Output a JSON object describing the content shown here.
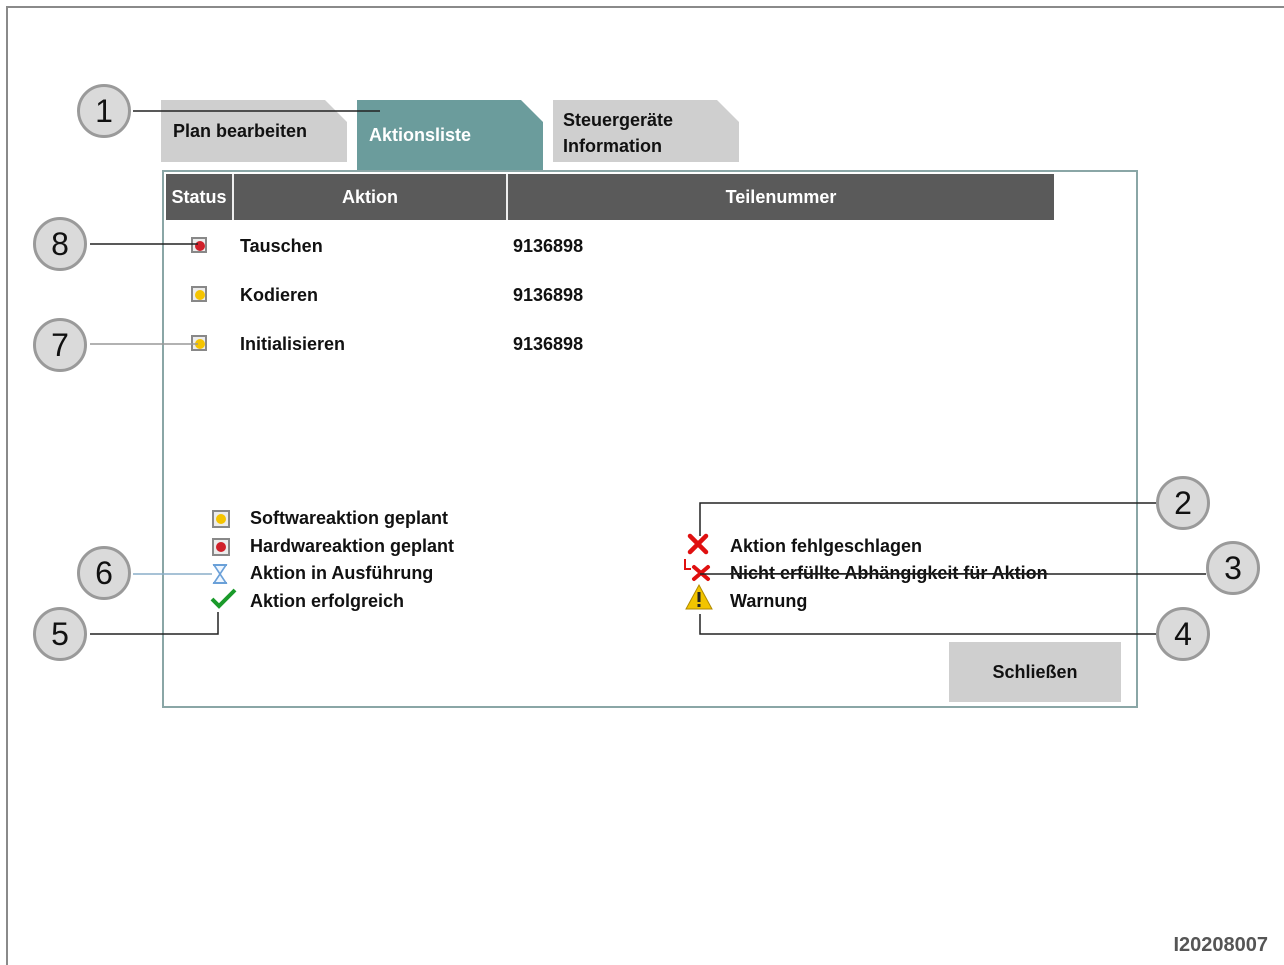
{
  "tabs": [
    {
      "label": "Plan bearbeiten",
      "active": false
    },
    {
      "label": "Aktionsliste",
      "active": true
    },
    {
      "label_line1": "Steuergeräte",
      "label_line2": "Information",
      "active": false
    }
  ],
  "table": {
    "headers": {
      "status": "Status",
      "aktion": "Aktion",
      "teilenummer": "Teilenummer"
    },
    "rows": [
      {
        "status": "hardware-planned",
        "aktion": "Tauschen",
        "teilenummer": "9136898"
      },
      {
        "status": "software-planned",
        "aktion": "Kodieren",
        "teilenummer": "9136898"
      },
      {
        "status": "software-planned",
        "aktion": "Initialisieren",
        "teilenummer": "9136898"
      }
    ]
  },
  "legend_left": [
    {
      "icon": "yellow-dot-icon",
      "label": "Softwareaktion geplant"
    },
    {
      "icon": "red-dot-icon",
      "label": "Hardwareaktion geplant"
    },
    {
      "icon": "hourglass-icon",
      "label": "Aktion in Ausführung"
    },
    {
      "icon": "check-icon",
      "label": "Aktion erfolgreich"
    }
  ],
  "legend_right": [
    {
      "icon": "red-x-icon",
      "label": "Aktion fehlgeschlagen"
    },
    {
      "icon": "dependency-x-icon",
      "label": "Nicht erfüllte Abhängigkeit für Aktion"
    },
    {
      "icon": "warning-icon",
      "label": "Warnung"
    }
  ],
  "close_button": "Schließen",
  "callouts": [
    "1",
    "2",
    "3",
    "4",
    "5",
    "6",
    "7",
    "8"
  ],
  "document_id": "I20208007",
  "colors": {
    "active_tab": "#6b9c9c",
    "inactive_tab": "#cfcfcf",
    "header_bg": "#5a5a5a",
    "software_dot": "#f5c400",
    "hardware_dot": "#d0202a",
    "success": "#1a9a2a",
    "error": "#e01010",
    "warning": "#f2c400"
  }
}
